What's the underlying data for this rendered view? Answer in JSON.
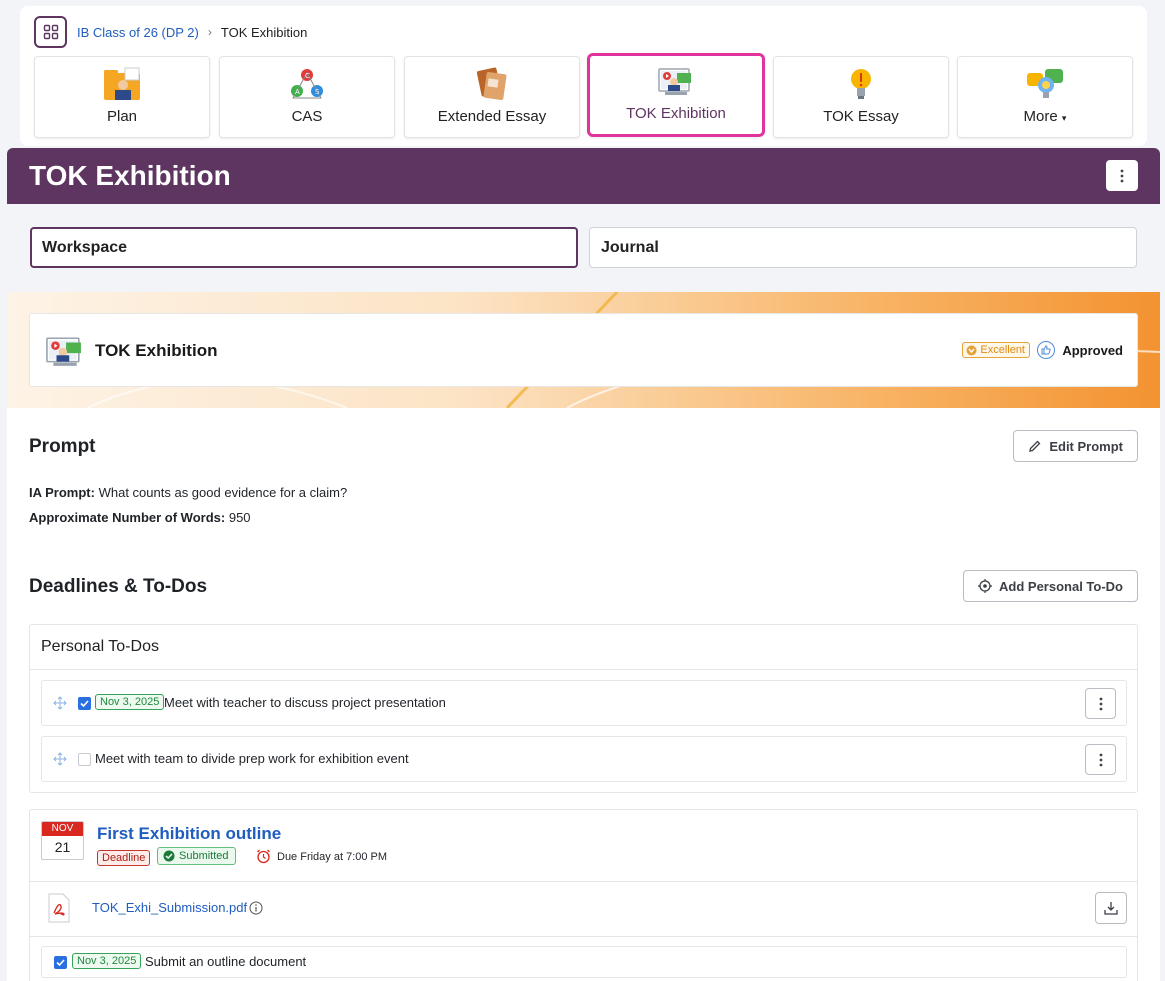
{
  "breadcrumb": {
    "parent": "IB Class of 26 (DP 2)",
    "current": "TOK Exhibition"
  },
  "tiles": [
    {
      "label": "Plan",
      "icon": "plan-folder-icon"
    },
    {
      "label": "CAS",
      "icon": "cas-triangle-icon"
    },
    {
      "label": "Extended Essay",
      "icon": "books-icon"
    },
    {
      "label": "TOK Exhibition",
      "icon": "exhibition-screen-icon",
      "active": true
    },
    {
      "label": "TOK Essay",
      "icon": "lightbulb-icon"
    },
    {
      "label": "More",
      "icon": "more-chat-icon"
    }
  ],
  "page": {
    "title": "TOK Exhibition"
  },
  "tabs": {
    "workspace": "Workspace",
    "journal": "Journal"
  },
  "banner": {
    "title": "TOK Exhibition",
    "badge": "Excellent",
    "status": "Approved"
  },
  "prompt": {
    "heading": "Prompt",
    "edit_label": "Edit Prompt",
    "ia_label": "IA Prompt:",
    "ia_value": "What counts as good evidence for a claim?",
    "words_label": "Approximate Number of Words:",
    "words_value": "950"
  },
  "deadlines": {
    "heading": "Deadlines & To-Dos",
    "add_label": "Add Personal To-Do",
    "personal_heading": "Personal To-Dos",
    "todos": [
      {
        "date": "Nov 3, 2025",
        "text": "Meet with teacher to discuss project presentation",
        "checked": true
      },
      {
        "date": "",
        "text": "Meet with team to divide prep work for exhibition event",
        "checked": false
      }
    ]
  },
  "assignment": {
    "month": "NOV",
    "day": "21",
    "title": "First Exhibition outline",
    "deadline_badge": "Deadline",
    "submitted_badge": "Submitted",
    "due": "Due Friday at 7:00 PM",
    "file": "TOK_Exhi_Submission.pdf",
    "subtask_date": "Nov 3, 2025",
    "subtask_text": "Submit an outline document"
  },
  "colors": {
    "brand_purple": "#5e3461",
    "active_tile": "#e0349c",
    "link_blue": "#1f5dbf",
    "orange": "#f39331"
  }
}
